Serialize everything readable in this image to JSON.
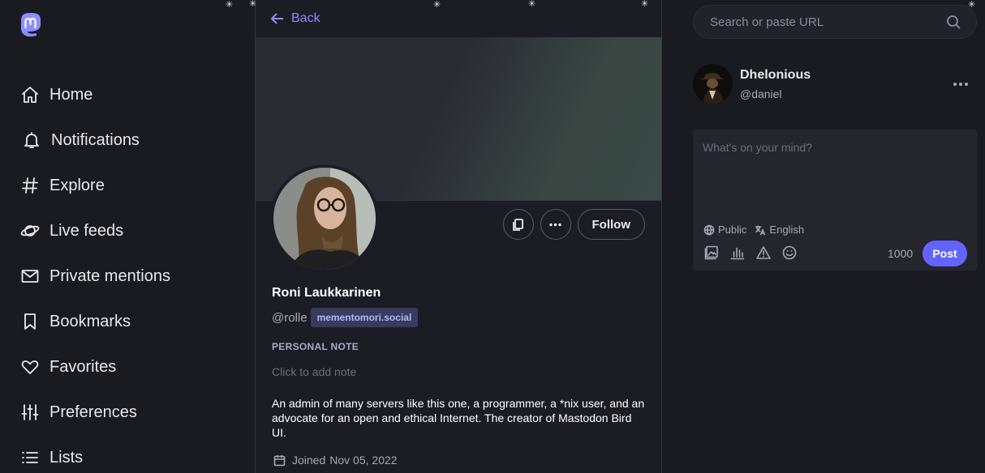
{
  "sidebar": {
    "items": [
      {
        "label": "Home",
        "icon": "home-icon"
      },
      {
        "label": "Notifications",
        "icon": "bell-icon"
      },
      {
        "label": "Explore",
        "icon": "hashtag-icon"
      },
      {
        "label": "Live feeds",
        "icon": "planet-icon"
      },
      {
        "label": "Private mentions",
        "icon": "envelope-icon"
      },
      {
        "label": "Bookmarks",
        "icon": "bookmark-icon"
      },
      {
        "label": "Favorites",
        "icon": "heart-icon"
      },
      {
        "label": "Preferences",
        "icon": "sliders-icon"
      },
      {
        "label": "Lists",
        "icon": "list-icon"
      }
    ]
  },
  "header": {
    "back_label": "Back"
  },
  "profile": {
    "name": "Roni Laukkarinen",
    "handle": "@rolle",
    "domain": "mementomori.social",
    "follow_label": "Follow",
    "note_label": "PERSONAL NOTE",
    "note_placeholder": "Click to add note",
    "bio": "An admin of many servers like this one, a programmer, a *nix user, and an advocate for an open and ethical Internet. The creator of Mastodon Bird UI.",
    "joined_label": "Joined",
    "joined_date": "Nov 05, 2022"
  },
  "search": {
    "placeholder": "Search or paste URL"
  },
  "account": {
    "name": "Dhelonious",
    "handle": "@daniel"
  },
  "compose": {
    "placeholder": "What's on your mind?",
    "visibility": "Public",
    "language": "English",
    "char_count": "1000",
    "post_label": "Post"
  },
  "colors": {
    "accent": "#6364ff",
    "link": "#8c8dff",
    "background": "#1c1c24"
  }
}
